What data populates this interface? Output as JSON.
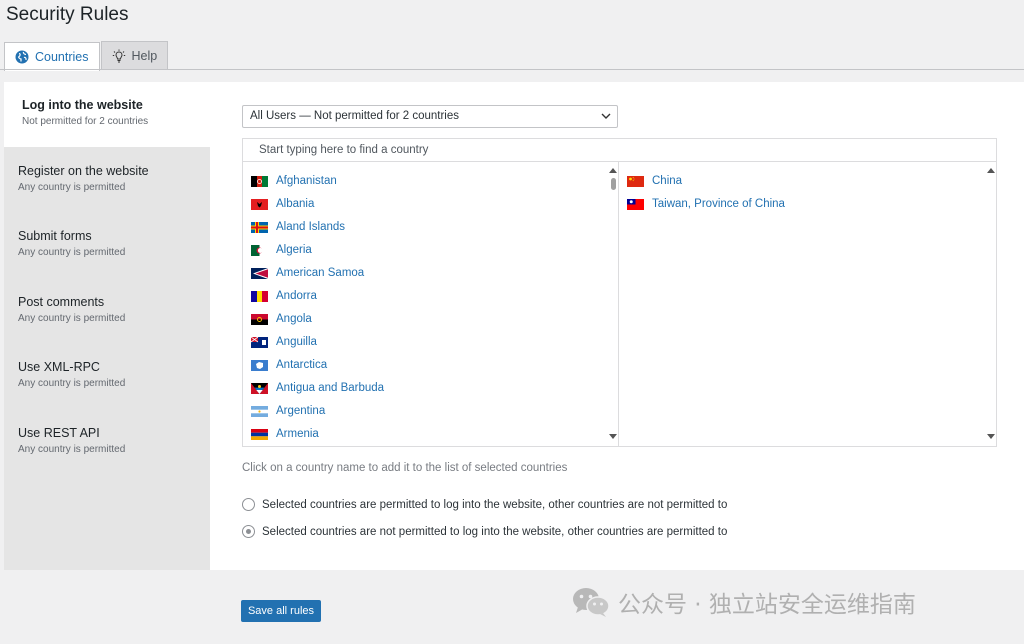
{
  "page": {
    "title": "Security Rules"
  },
  "tabs": [
    {
      "label": "Countries",
      "icon": "globe-icon"
    },
    {
      "label": "Help",
      "icon": "lightbulb-icon"
    }
  ],
  "sidebar": {
    "items": [
      {
        "title": "Log into the website",
        "sub": "Not permitted for 2 countries"
      },
      {
        "title": "Register on the website",
        "sub": "Any country is permitted"
      },
      {
        "title": "Submit forms",
        "sub": "Any country is permitted"
      },
      {
        "title": "Post comments",
        "sub": "Any country is permitted"
      },
      {
        "title": "Use XML-RPC",
        "sub": "Any country is permitted"
      },
      {
        "title": "Use REST API",
        "sub": "Any country is permitted"
      }
    ]
  },
  "main": {
    "select_value": "All Users — Not permitted for 2 countries",
    "search_placeholder": "Start typing here to find a country",
    "available_countries": [
      "Afghanistan",
      "Albania",
      "Aland Islands",
      "Algeria",
      "American Samoa",
      "Andorra",
      "Angola",
      "Anguilla",
      "Antarctica",
      "Antigua and Barbuda",
      "Argentina",
      "Armenia"
    ],
    "selected_countries": [
      "China",
      "Taiwan, Province of China"
    ],
    "hint": "Click on a country name to add it to the list of selected countries",
    "radio_options": [
      "Selected countries are permitted to log into the website, other countries are not permitted to",
      "Selected countries are not permitted to log into the website, other countries are permitted to"
    ],
    "radio_checked_index": 1
  },
  "footer": {
    "save_label": "Save all rules",
    "watermark": "公众号 · 独立站安全运维指南",
    "watermark_icon": "wechat-icon"
  },
  "colors": {
    "accent": "#2271b1",
    "sidebar_bg": "#e5e5e5",
    "page_bg": "#f0f0f1"
  }
}
